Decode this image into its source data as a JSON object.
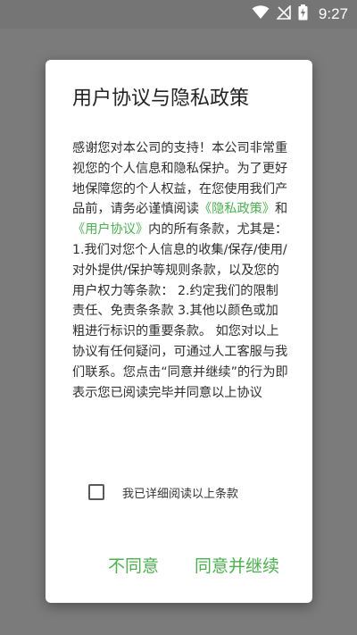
{
  "status_bar": {
    "time": "9:27",
    "icons": [
      "wifi-icon",
      "no-signal-icon",
      "battery-charging-icon"
    ]
  },
  "dialog": {
    "title": "用户协议与隐私政策",
    "body_intro": "感谢您对本公司的支持！本公司非常重视您的个人信息和隐私保护。为了更好地保障您的个人权益，在您使用我们产品前，请务必谨慎阅读",
    "privacy_link": "《隐私政策》",
    "and_text": "和",
    "agreement_link": "《用户协议》",
    "body_rest": "内的所有条款，尤其是：  1.我们对您个人信息的收集/保存/使用/对外提供/保护等规则条款，以及您的用户权力等条款：  2.约定我们的限制责任、免责条条款  3.其他以颜色或加粗进行标识的重要条款。  如您对以上协议有任何疑问，可通过人工客服与我们联系。您点击“同意并继续”的行为即表示您已阅读完毕并同意以上协议",
    "checkbox_label": "我已详细阅读以上条款",
    "disagree_button": "不同意",
    "agree_button": "同意并继续"
  },
  "colors": {
    "accent": "#4caf50",
    "overlay": "#7b7b7b"
  }
}
